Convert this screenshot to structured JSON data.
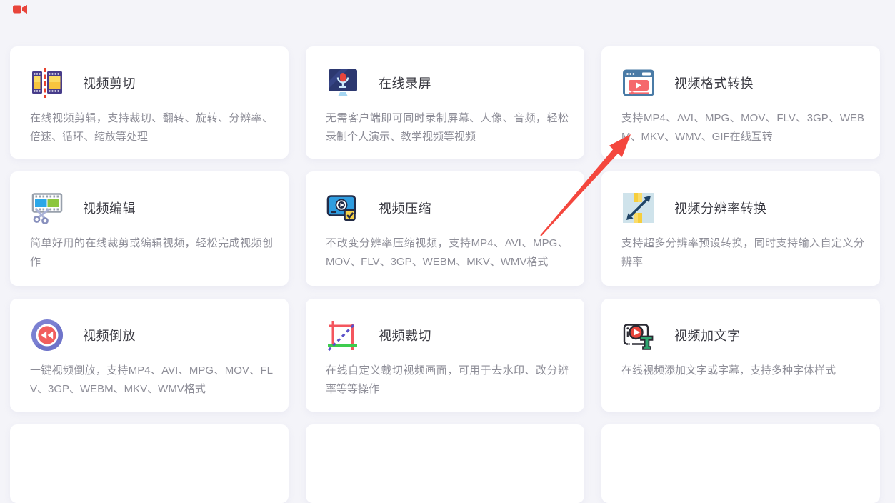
{
  "colors": {
    "page-bg": "#f4f4f9",
    "card-bg": "#ffffff",
    "title-color": "#3a3a42",
    "desc-color": "#8d8d97",
    "arrow-red": "#f4473e"
  },
  "cards": [
    {
      "icon": "film-cut-icon",
      "title": "视频剪切",
      "desc": "在线视频剪辑，支持裁切、翻转、旋转、分辨率、倍速、循环、缩放等处理"
    },
    {
      "icon": "screen-record-icon",
      "title": "在线录屏",
      "desc": "无需客户端即可同时录制屏幕、人像、音频，轻松录制个人演示、教学视频等视频"
    },
    {
      "icon": "format-convert-icon",
      "title": "视频格式转换",
      "desc": "支持MP4、AVI、MPG、MOV、FLV、3GP、WEBM、MKV、WMV、GIF在线互转"
    },
    {
      "icon": "film-edit-icon",
      "title": "视频编辑",
      "desc": "简单好用的在线裁剪或编辑视频，轻松完成视频创作"
    },
    {
      "icon": "video-compress-icon",
      "title": "视频压缩",
      "desc": "不改变分辨率压缩视频，支持MP4、AVI、MPG、MOV、FLV、3GP、WEBM、MKV、WMV格式"
    },
    {
      "icon": "resolution-convert-icon",
      "title": "视频分辨率转换",
      "desc": "支持超多分辨率预设转换，同时支持输入自定义分辨率"
    },
    {
      "icon": "rewind-icon",
      "title": "视频倒放",
      "desc": "一键视频倒放，支持MP4、AVI、MPG、MOV、FLV、3GP、WEBM、MKV、WMV格式"
    },
    {
      "icon": "crop-icon",
      "title": "视频裁切",
      "desc": "在线自定义裁切视频画面，可用于去水印、改分辨率等等操作"
    },
    {
      "icon": "add-text-icon",
      "title": "视频加文字",
      "desc": "在线视频添加文字或字幕，支持多种字体样式"
    }
  ]
}
